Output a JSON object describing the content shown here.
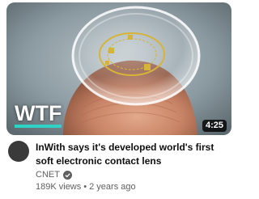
{
  "video": {
    "title": "InWith says it's developed world's first soft electronic contact lens",
    "channel": "CNET",
    "views": "189K views",
    "separator": "•",
    "age": "2 years ago",
    "duration": "4:25",
    "thumbnail_logo": "WTF",
    "icons": {
      "verified": "verified-check-icon",
      "avatar": "channel-avatar"
    },
    "colors": {
      "logo_accent": "#2fd3c6",
      "lens_circuit": "#d6b43a"
    }
  }
}
